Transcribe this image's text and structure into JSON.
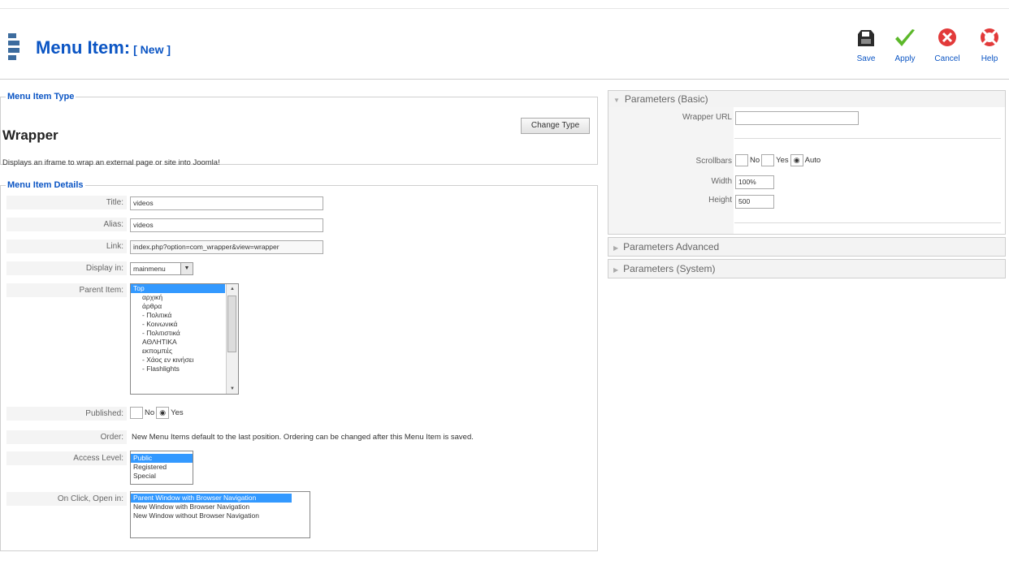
{
  "header": {
    "title": "Menu Item:",
    "subtitle": "[ New ]",
    "toolbar": [
      {
        "label": "Save",
        "icon": "save-icon"
      },
      {
        "label": "Apply",
        "icon": "apply-icon"
      },
      {
        "label": "Cancel",
        "icon": "cancel-icon"
      },
      {
        "label": "Help",
        "icon": "help-icon"
      }
    ]
  },
  "type_section": {
    "legend": "Menu Item Type",
    "type_name": "Wrapper",
    "description": "Displays an iframe to wrap an external page or site into Joomla!",
    "change_button": "Change Type"
  },
  "details": {
    "legend": "Menu Item Details",
    "title_label": "Title:",
    "title_value": "videos",
    "alias_label": "Alias:",
    "alias_value": "videos",
    "link_label": "Link:",
    "link_value": "index.php?option=com_wrapper&view=wrapper",
    "display_label": "Display in:",
    "display_value": "mainmenu",
    "parent_label": "Parent Item:",
    "parent_options": [
      "Top",
      "αρχική",
      "άρθρα",
      "- Πολιτικά",
      "- Κοινωνικά",
      "- Πολιτιστικά",
      "ΑΘΛΗΤΙΚΑ",
      "εκπομπές",
      "- Χάος εν κινήσει",
      "- Flashlights"
    ],
    "published_label": "Published:",
    "published_no": "No",
    "published_yes": "Yes",
    "order_label": "Order:",
    "order_text": "New Menu Items default to the last position. Ordering can be changed after this Menu Item is saved.",
    "access_label": "Access Level:",
    "access_options": [
      "Public",
      "Registered",
      "Special"
    ],
    "onclick_label": "On Click, Open in:",
    "onclick_options": [
      "Parent Window with Browser Navigation",
      "New Window with Browser Navigation",
      "New Window without Browser Navigation"
    ]
  },
  "params_basic": {
    "title": "Parameters (Basic)",
    "wrapper_url_label": "Wrapper URL",
    "wrapper_url_value": "",
    "scrollbars_label": "Scrollbars",
    "scroll_no": "No",
    "scroll_yes": "Yes",
    "scroll_auto": "Auto",
    "width_label": "Width",
    "width_value": "100%",
    "height_label": "Height",
    "height_value": "500"
  },
  "params_advanced": {
    "title": "Parameters Advanced"
  },
  "params_system": {
    "title": "Parameters (System)"
  },
  "colors": {
    "accent": "#0b55c4",
    "selection": "#3399ff",
    "border": "#cfcfcf"
  }
}
